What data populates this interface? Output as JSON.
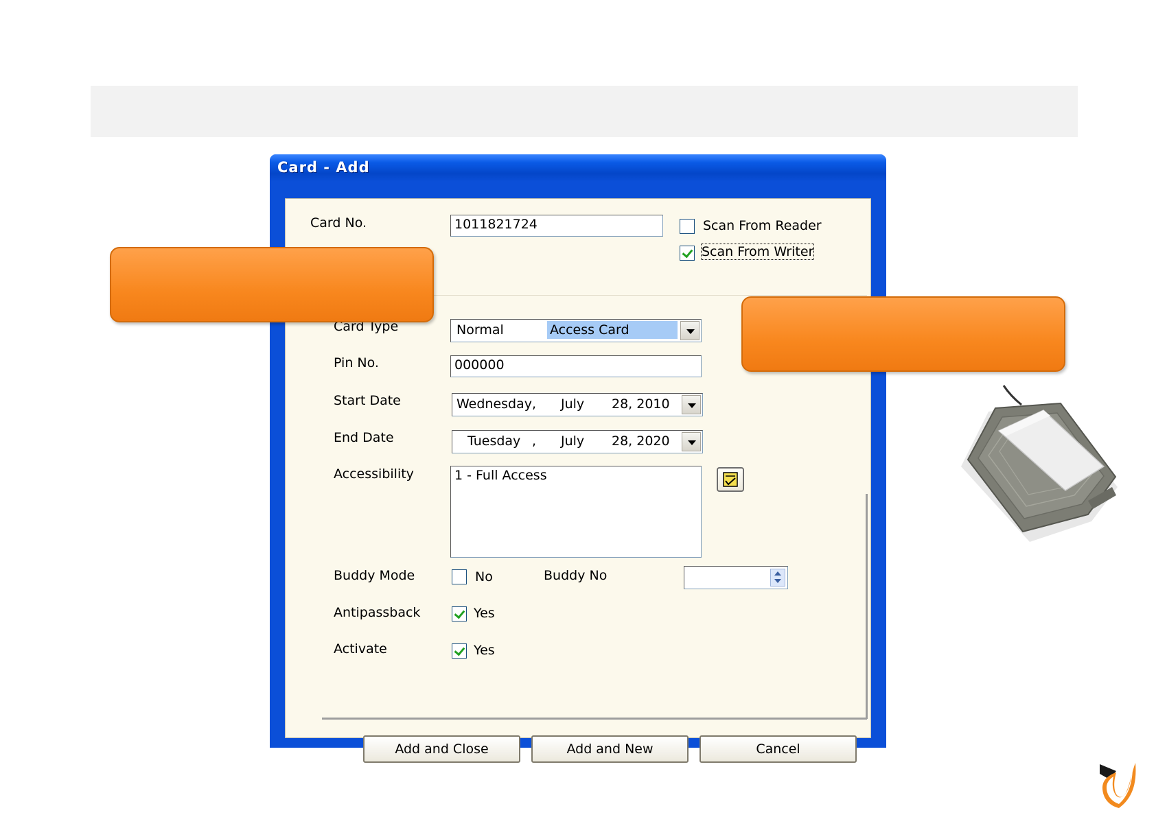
{
  "window": {
    "title": "Card - Add"
  },
  "form": {
    "card_no_label": "Card No.",
    "card_no_value": "1011821724",
    "scan_reader_label": "Scan From Reader",
    "scan_reader_checked": false,
    "scan_writer_label": "Scan From Writer",
    "scan_writer_checked": true,
    "card_type_label": "Card Type",
    "card_type_value_normal": "Normal",
    "card_type_value_access": "Access Card",
    "pin_label": "Pin No.",
    "pin_value": "000000",
    "start_date_label": "Start Date",
    "start_date_day": "Wednesday,",
    "start_date_month": "July",
    "start_date_date": "28, 2010",
    "end_date_label": "End Date",
    "end_date_day": "Tuesday",
    "end_date_comma": ",",
    "end_date_month": "July",
    "end_date_date": "28, 2020",
    "accessibility_label": "Accessibility",
    "accessibility_value": "1 - Full Access",
    "buddy_mode_label": "Buddy Mode",
    "buddy_mode_value": "No",
    "buddy_mode_checked": false,
    "buddy_no_label": "Buddy No",
    "buddy_no_value": "",
    "antipassback_label": "Antipassback",
    "antipassback_value": "Yes",
    "antipassback_checked": true,
    "activate_label": "Activate",
    "activate_value": "Yes",
    "activate_checked": true
  },
  "buttons": {
    "add_close": "Add and Close",
    "add_new": "Add and New",
    "cancel": "Cancel"
  },
  "colors": {
    "callout": "#f8871e",
    "titlebar": "#0b4fd8",
    "selection": "#a6cbf6"
  },
  "icons": [
    "dropdown-arrow-icon",
    "checklist-icon",
    "spinner-icon",
    "card-reader-device",
    "brand-logo-icon"
  ]
}
